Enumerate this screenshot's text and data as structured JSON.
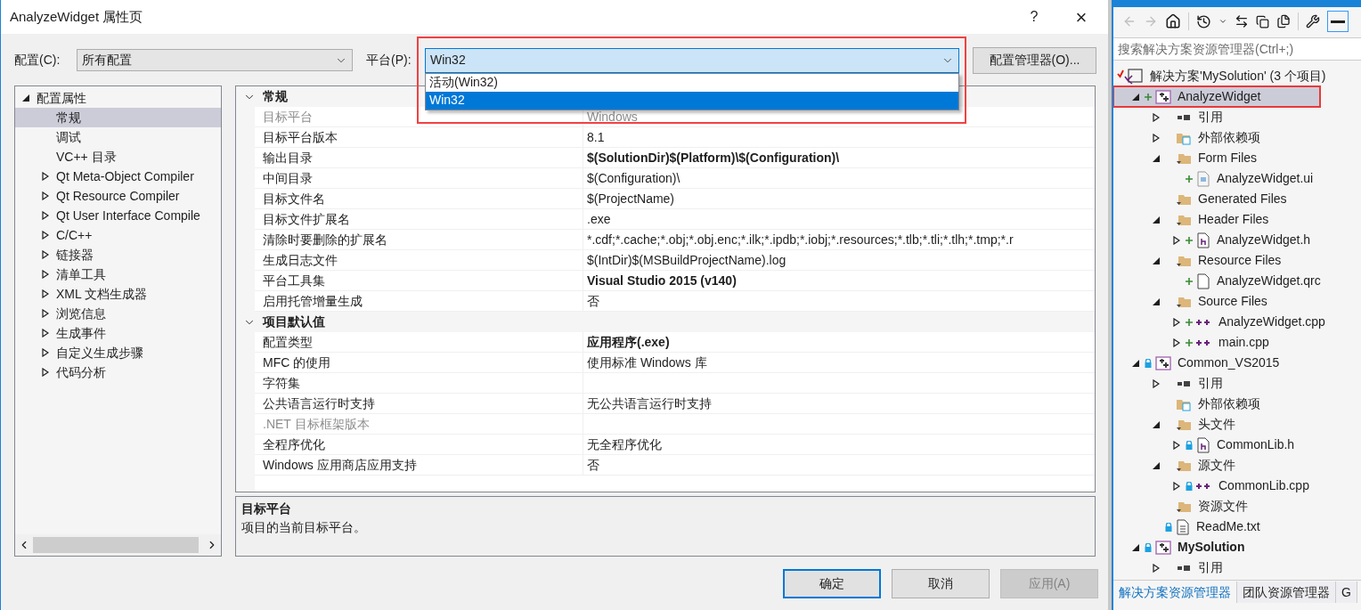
{
  "dialog": {
    "title": "AnalyzeWidget 属性页",
    "help": "?",
    "close": "×",
    "config": {
      "label": "配置(C):",
      "value": "所有配置"
    },
    "platform": {
      "label": "平台(P):",
      "value": "Win32",
      "options": [
        {
          "label": "活动(Win32)",
          "selected": false
        },
        {
          "label": "Win32",
          "selected": true
        }
      ]
    },
    "config_manager": "配置管理器(O)...",
    "nav": [
      {
        "label": "配置属性",
        "expandable": true,
        "expanded": true,
        "selected": false,
        "children": [
          {
            "label": "常规",
            "expandable": false,
            "selected": true
          },
          {
            "label": "调试",
            "expandable": false,
            "selected": false
          },
          {
            "label": "VC++ 目录",
            "expandable": false,
            "selected": false
          },
          {
            "label": "Qt Meta-Object Compiler",
            "expandable": true,
            "expanded": false,
            "selected": false
          },
          {
            "label": "Qt Resource Compiler",
            "expandable": true,
            "expanded": false,
            "selected": false
          },
          {
            "label": "Qt User Interface Compile",
            "expandable": true,
            "expanded": false,
            "selected": false
          },
          {
            "label": "C/C++",
            "expandable": true,
            "expanded": false,
            "selected": false
          },
          {
            "label": "链接器",
            "expandable": true,
            "expanded": false,
            "selected": false
          },
          {
            "label": "清单工具",
            "expandable": true,
            "expanded": false,
            "selected": false
          },
          {
            "label": "XML 文档生成器",
            "expandable": true,
            "expanded": false,
            "selected": false
          },
          {
            "label": "浏览信息",
            "expandable": true,
            "expanded": false,
            "selected": false
          },
          {
            "label": "生成事件",
            "expandable": true,
            "expanded": false,
            "selected": false
          },
          {
            "label": "自定义生成步骤",
            "expandable": true,
            "expanded": false,
            "selected": false
          },
          {
            "label": "代码分析",
            "expandable": true,
            "expanded": false,
            "selected": false
          }
        ]
      }
    ],
    "sections": [
      {
        "title": "常规",
        "expanded": true,
        "rows": [
          {
            "name": "目标平台",
            "value": "Windows",
            "bold": false,
            "disabled": true
          },
          {
            "name": "目标平台版本",
            "value": "8.1",
            "bold": false,
            "disabled": false
          },
          {
            "name": "输出目录",
            "value": "$(SolutionDir)$(Platform)\\$(Configuration)\\",
            "bold": true,
            "disabled": false
          },
          {
            "name": "中间目录",
            "value": "$(Configuration)\\",
            "bold": false,
            "disabled": false
          },
          {
            "name": "目标文件名",
            "value": "$(ProjectName)",
            "bold": false,
            "disabled": false
          },
          {
            "name": "目标文件扩展名",
            "value": ".exe",
            "bold": false,
            "disabled": false
          },
          {
            "name": "清除时要删除的扩展名",
            "value": "*.cdf;*.cache;*.obj;*.obj.enc;*.ilk;*.ipdb;*.iobj;*.resources;*.tlb;*.tli;*.tlh;*.tmp;*.r",
            "bold": false,
            "disabled": false
          },
          {
            "name": "生成日志文件",
            "value": "$(IntDir)$(MSBuildProjectName).log",
            "bold": false,
            "disabled": false
          },
          {
            "name": "平台工具集",
            "value": "Visual Studio 2015 (v140)",
            "bold": true,
            "disabled": false
          },
          {
            "name": "启用托管增量生成",
            "value": "否",
            "bold": false,
            "disabled": false
          }
        ]
      },
      {
        "title": "项目默认值",
        "expanded": true,
        "rows": [
          {
            "name": "配置类型",
            "value": "应用程序(.exe)",
            "bold": true,
            "disabled": false
          },
          {
            "name": "MFC 的使用",
            "value": "使用标准 Windows 库",
            "bold": false,
            "disabled": false
          },
          {
            "name": "字符集",
            "disabled": false
          },
          {
            "name": "公共语言运行时支持",
            "value": "无公共语言运行时支持",
            "bold": false,
            "disabled": false
          },
          {
            "name": ".NET 目标框架版本",
            "disabled": true
          },
          {
            "name": "全程序优化",
            "value": "无全程序优化",
            "bold": false,
            "disabled": false
          },
          {
            "name": "Windows 应用商店应用支持",
            "value": "否",
            "bold": false,
            "disabled": false
          }
        ]
      }
    ],
    "description": {
      "title": "目标平台",
      "text": "项目的当前目标平台。"
    },
    "buttons": [
      {
        "label": "确定",
        "kind": "default",
        "disabled": false
      },
      {
        "label": "取消",
        "kind": "normal",
        "disabled": false
      },
      {
        "label": "应用(A)",
        "kind": "normal",
        "disabled": true
      }
    ]
  },
  "explorer": {
    "search": {
      "placeholder": "搜索解决方案资源管理器(Ctrl+;)"
    },
    "tree": [
      {
        "label": "解决方案'MySolution' (3 个项目)",
        "kind": "solution",
        "expandable": false,
        "added": false,
        "locked": false,
        "selected": false,
        "bold": false,
        "children": [
          {
            "label": "AnalyzeWidget",
            "kind": "project",
            "expandable": true,
            "expanded": true,
            "added": true,
            "locked": false,
            "selected": true,
            "bold": false,
            "children": [
              {
                "label": "引用",
                "kind": "references",
                "expandable": true,
                "expanded": false,
                "added": false,
                "locked": false,
                "selected": false,
                "bold": false
              },
              {
                "label": "外部依赖项",
                "kind": "external",
                "expandable": true,
                "expanded": false,
                "added": false,
                "locked": false,
                "selected": false,
                "bold": false
              },
              {
                "label": "Form Files",
                "kind": "filter",
                "expandable": true,
                "expanded": true,
                "added": false,
                "locked": false,
                "selected": false,
                "bold": false,
                "children": [
                  {
                    "label": "AnalyzeWidget.ui",
                    "kind": "ui",
                    "expandable": false,
                    "added": true,
                    "locked": false,
                    "selected": false,
                    "bold": false
                  }
                ]
              },
              {
                "label": "Generated Files",
                "kind": "filter",
                "expandable": false,
                "added": false,
                "locked": false,
                "selected": false,
                "bold": false
              },
              {
                "label": "Header Files",
                "kind": "filter",
                "expandable": true,
                "expanded": true,
                "added": false,
                "locked": false,
                "selected": false,
                "bold": false,
                "children": [
                  {
                    "label": "AnalyzeWidget.h",
                    "kind": "header",
                    "expandable": true,
                    "expanded": false,
                    "added": true,
                    "locked": false,
                    "selected": false,
                    "bold": false
                  }
                ]
              },
              {
                "label": "Resource Files",
                "kind": "filter",
                "expandable": true,
                "expanded": true,
                "added": false,
                "locked": false,
                "selected": false,
                "bold": false,
                "children": [
                  {
                    "label": "AnalyzeWidget.qrc",
                    "kind": "file",
                    "expandable": false,
                    "added": true,
                    "locked": false,
                    "selected": false,
                    "bold": false
                  }
                ]
              },
              {
                "label": "Source Files",
                "kind": "filter",
                "expandable": true,
                "expanded": true,
                "added": false,
                "locked": false,
                "selected": false,
                "bold": false,
                "children": [
                  {
                    "label": "AnalyzeWidget.cpp",
                    "kind": "cpp",
                    "expandable": true,
                    "expanded": false,
                    "added": true,
                    "locked": false,
                    "selected": false,
                    "bold": false
                  },
                  {
                    "label": "main.cpp",
                    "kind": "cpp",
                    "expandable": true,
                    "expanded": false,
                    "added": true,
                    "locked": false,
                    "selected": false,
                    "bold": false
                  }
                ]
              }
            ]
          },
          {
            "label": "Common_VS2015",
            "kind": "project",
            "expandable": true,
            "expanded": true,
            "added": false,
            "locked": true,
            "selected": false,
            "bold": false,
            "children": [
              {
                "label": "引用",
                "kind": "references",
                "expandable": true,
                "expanded": false,
                "added": false,
                "locked": false,
                "selected": false,
                "bold": false
              },
              {
                "label": "外部依赖项",
                "kind": "external",
                "expandable": false,
                "added": false,
                "locked": false,
                "selected": false,
                "bold": false
              },
              {
                "label": "头文件",
                "kind": "filter",
                "expandable": true,
                "expanded": true,
                "added": false,
                "locked": false,
                "selected": false,
                "bold": false,
                "children": [
                  {
                    "label": "CommonLib.h",
                    "kind": "header",
                    "expandable": true,
                    "expanded": false,
                    "added": false,
                    "locked": true,
                    "selected": false,
                    "bold": false
                  }
                ]
              },
              {
                "label": "源文件",
                "kind": "filter",
                "expandable": true,
                "expanded": true,
                "added": false,
                "locked": false,
                "selected": false,
                "bold": false,
                "children": [
                  {
                    "label": "CommonLib.cpp",
                    "kind": "cpp",
                    "expandable": true,
                    "expanded": false,
                    "added": false,
                    "locked": true,
                    "selected": false,
                    "bold": false
                  }
                ]
              },
              {
                "label": "资源文件",
                "kind": "filter",
                "expandable": false,
                "added": false,
                "locked": false,
                "selected": false,
                "bold": false
              },
              {
                "label": "ReadMe.txt",
                "kind": "text",
                "expandable": false,
                "added": false,
                "locked": true,
                "selected": false,
                "bold": false
              }
            ]
          },
          {
            "label": "MySolution",
            "kind": "project",
            "expandable": true,
            "expanded": true,
            "added": false,
            "locked": true,
            "selected": false,
            "bold": true,
            "children": [
              {
                "label": "引用",
                "kind": "references",
                "expandable": true,
                "expanded": false,
                "added": false,
                "locked": false,
                "selected": false,
                "bold": false
              }
            ]
          }
        ]
      }
    ],
    "tabs": [
      {
        "label": "解决方案资源管理器",
        "selected": true
      },
      {
        "label": "团队资源管理器",
        "selected": false
      },
      {
        "label": "G",
        "selected": false
      }
    ]
  }
}
